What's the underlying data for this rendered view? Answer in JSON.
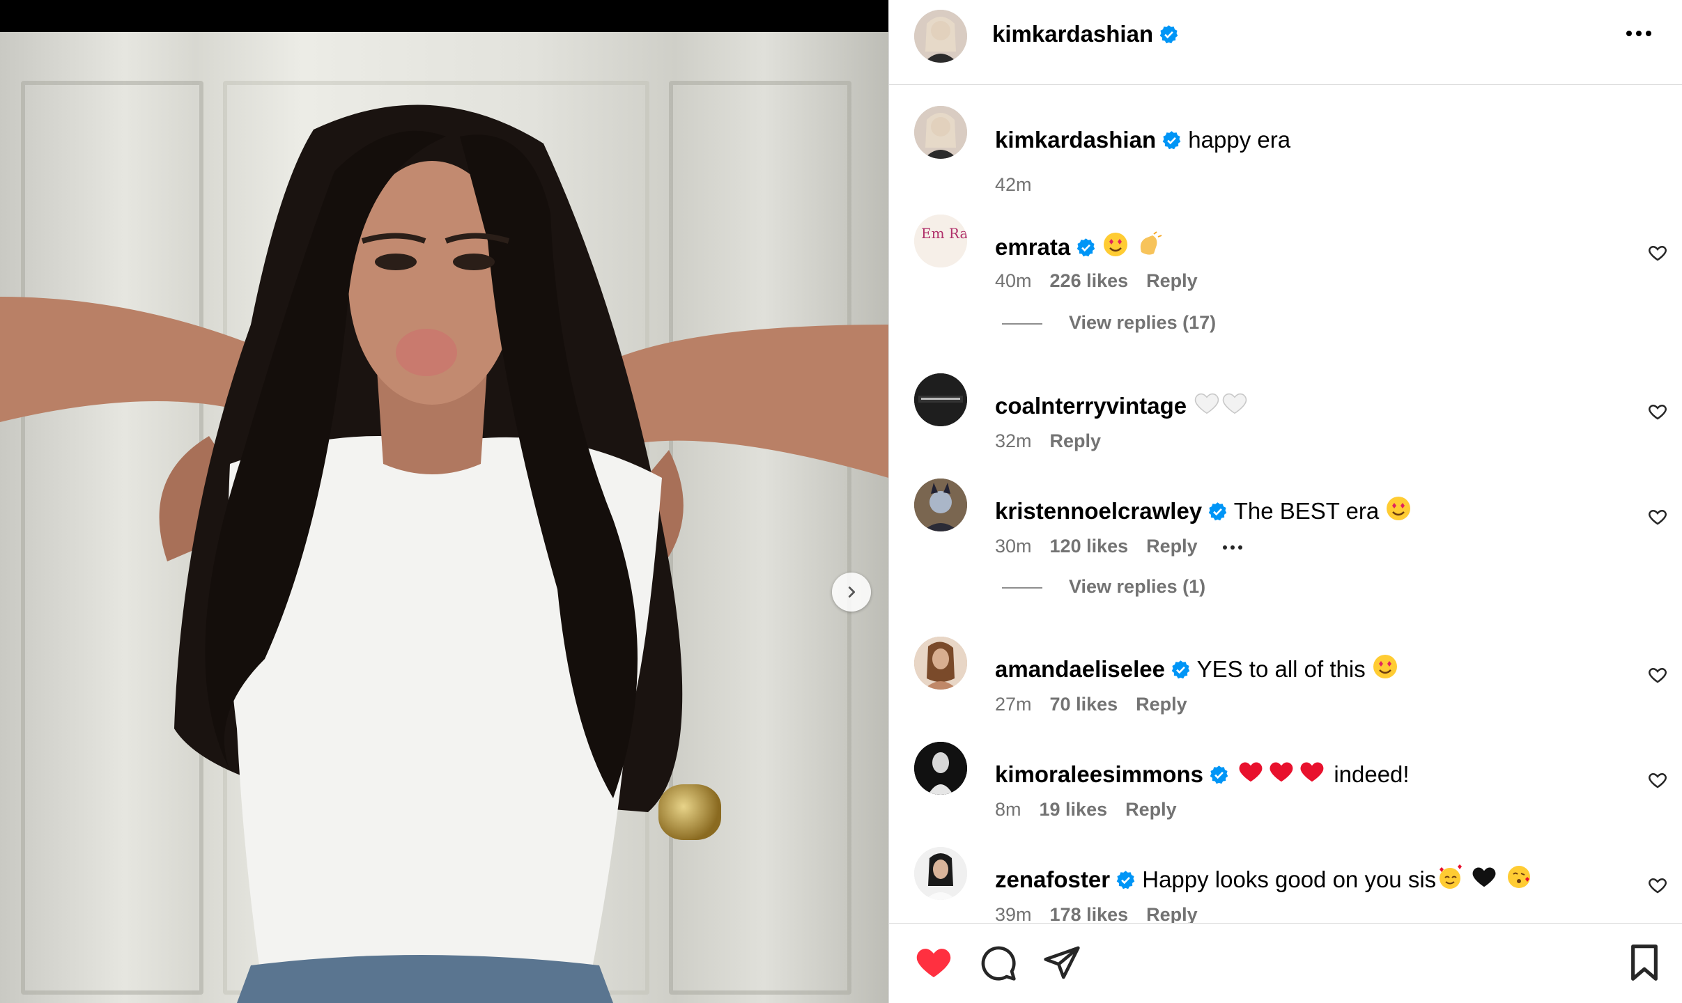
{
  "post": {
    "author": "kimkardashian",
    "caption_author": "kimkardashian",
    "caption_text": "happy era",
    "caption_time": "42m"
  },
  "comments": [
    {
      "user": "emrata",
      "text": "",
      "time": "40m",
      "likes": "226 likes",
      "reply": "Reply",
      "view_replies": "View replies (17)"
    },
    {
      "user": "coalnterryvintage",
      "text": "",
      "time": "32m",
      "likes": "",
      "reply": "Reply",
      "view_replies": ""
    },
    {
      "user": "kristennoelcrawley",
      "text": "The BEST era",
      "time": "30m",
      "likes": "120 likes",
      "reply": "Reply",
      "view_replies": "View replies (1)"
    },
    {
      "user": "amandaeliselee",
      "text": "YES to all of this",
      "time": "27m",
      "likes": "70 likes",
      "reply": "Reply",
      "view_replies": ""
    },
    {
      "user": "kimoraleesimmons",
      "text": "indeed!",
      "time": "8m",
      "likes": "19 likes",
      "reply": "Reply",
      "view_replies": ""
    },
    {
      "user": "zenafoster",
      "text": "Happy looks good on you sis",
      "time": "39m",
      "likes": "178 likes",
      "reply": "Reply",
      "view_replies": ""
    }
  ],
  "emrata_avatar_text": "Em Rata",
  "colors": {
    "verified": "#0095f6",
    "like_red": "#ff3040",
    "muted": "#737373"
  },
  "icons": [
    "verified-badge-icon",
    "more-options-icon",
    "heart-icon",
    "comment-icon",
    "share-icon",
    "bookmark-icon",
    "chevron-right-icon"
  ]
}
